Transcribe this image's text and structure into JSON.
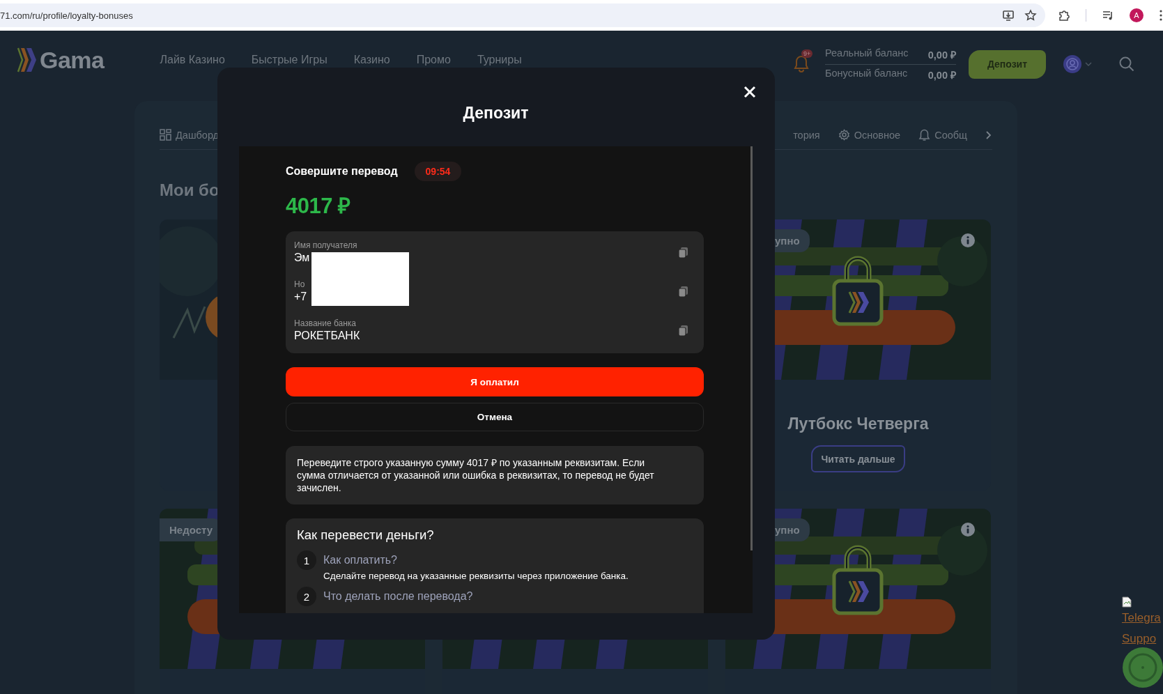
{
  "browser": {
    "url": "71.com/ru/profile/loyalty-bonuses",
    "profile_initial": "A"
  },
  "header": {
    "logo": "Gama",
    "nav": [
      "Лайв Казино",
      "Быстрые Игры",
      "Казино",
      "Промо",
      "Турниры"
    ],
    "notification_badge": "9+",
    "balances": [
      {
        "label": "Реальный баланс",
        "value": "0,00 ₽"
      },
      {
        "label": "Бонусный баланс",
        "value": "0,00 ₽"
      }
    ],
    "deposit_button": "Депозит"
  },
  "profile_tabs": [
    "Дашборд",
    "тория",
    "Основное",
    "Сообщ"
  ],
  "section_title": "Мои бо",
  "card_rows": [
    {
      "cards": [
        {
          "kind": "picture"
        },
        {
          "kind": "blank"
        },
        {
          "kind": "picture",
          "badge": "упно",
          "locked": true,
          "title": "Лутбокс Четверга",
          "button": "Читать дальше"
        }
      ]
    },
    {
      "cards": [
        {
          "kind": "picture",
          "badge": "Недосту"
        },
        {
          "kind": "picture"
        },
        {
          "kind": "picture",
          "badge": "упно",
          "locked": true
        }
      ]
    }
  ],
  "modal": {
    "title": "Депозит",
    "transfer_label": "Совершите перевод",
    "timer": "09:54",
    "amount": "4017 ₽",
    "redaction": true,
    "details": [
      {
        "label": "Имя получателя",
        "value": "Эм"
      },
      {
        "label": "Но",
        "value": "+7"
      },
      {
        "label": "Название банка",
        "value": "РОКЕТБАНК"
      }
    ],
    "confirm_button": "Я оплатил",
    "cancel_button": "Отмена",
    "notice": "Переведите строго указанную сумму 4017 ₽ по указанным реквизитам. Если сумма отличается от указанной или ошибка в реквизитах, то перевод не будет зачислен.",
    "howto": {
      "title": "Как перевести деньги?",
      "steps": [
        {
          "number": "1",
          "question": "Как оплатить?",
          "answer": "Сделайте перевод на указанные реквизиты через приложение банка."
        },
        {
          "number": "2",
          "question": "Что делать после перевода?"
        }
      ]
    }
  },
  "support": {
    "link_lines": [
      "Telegra",
      "Suppo"
    ]
  }
}
